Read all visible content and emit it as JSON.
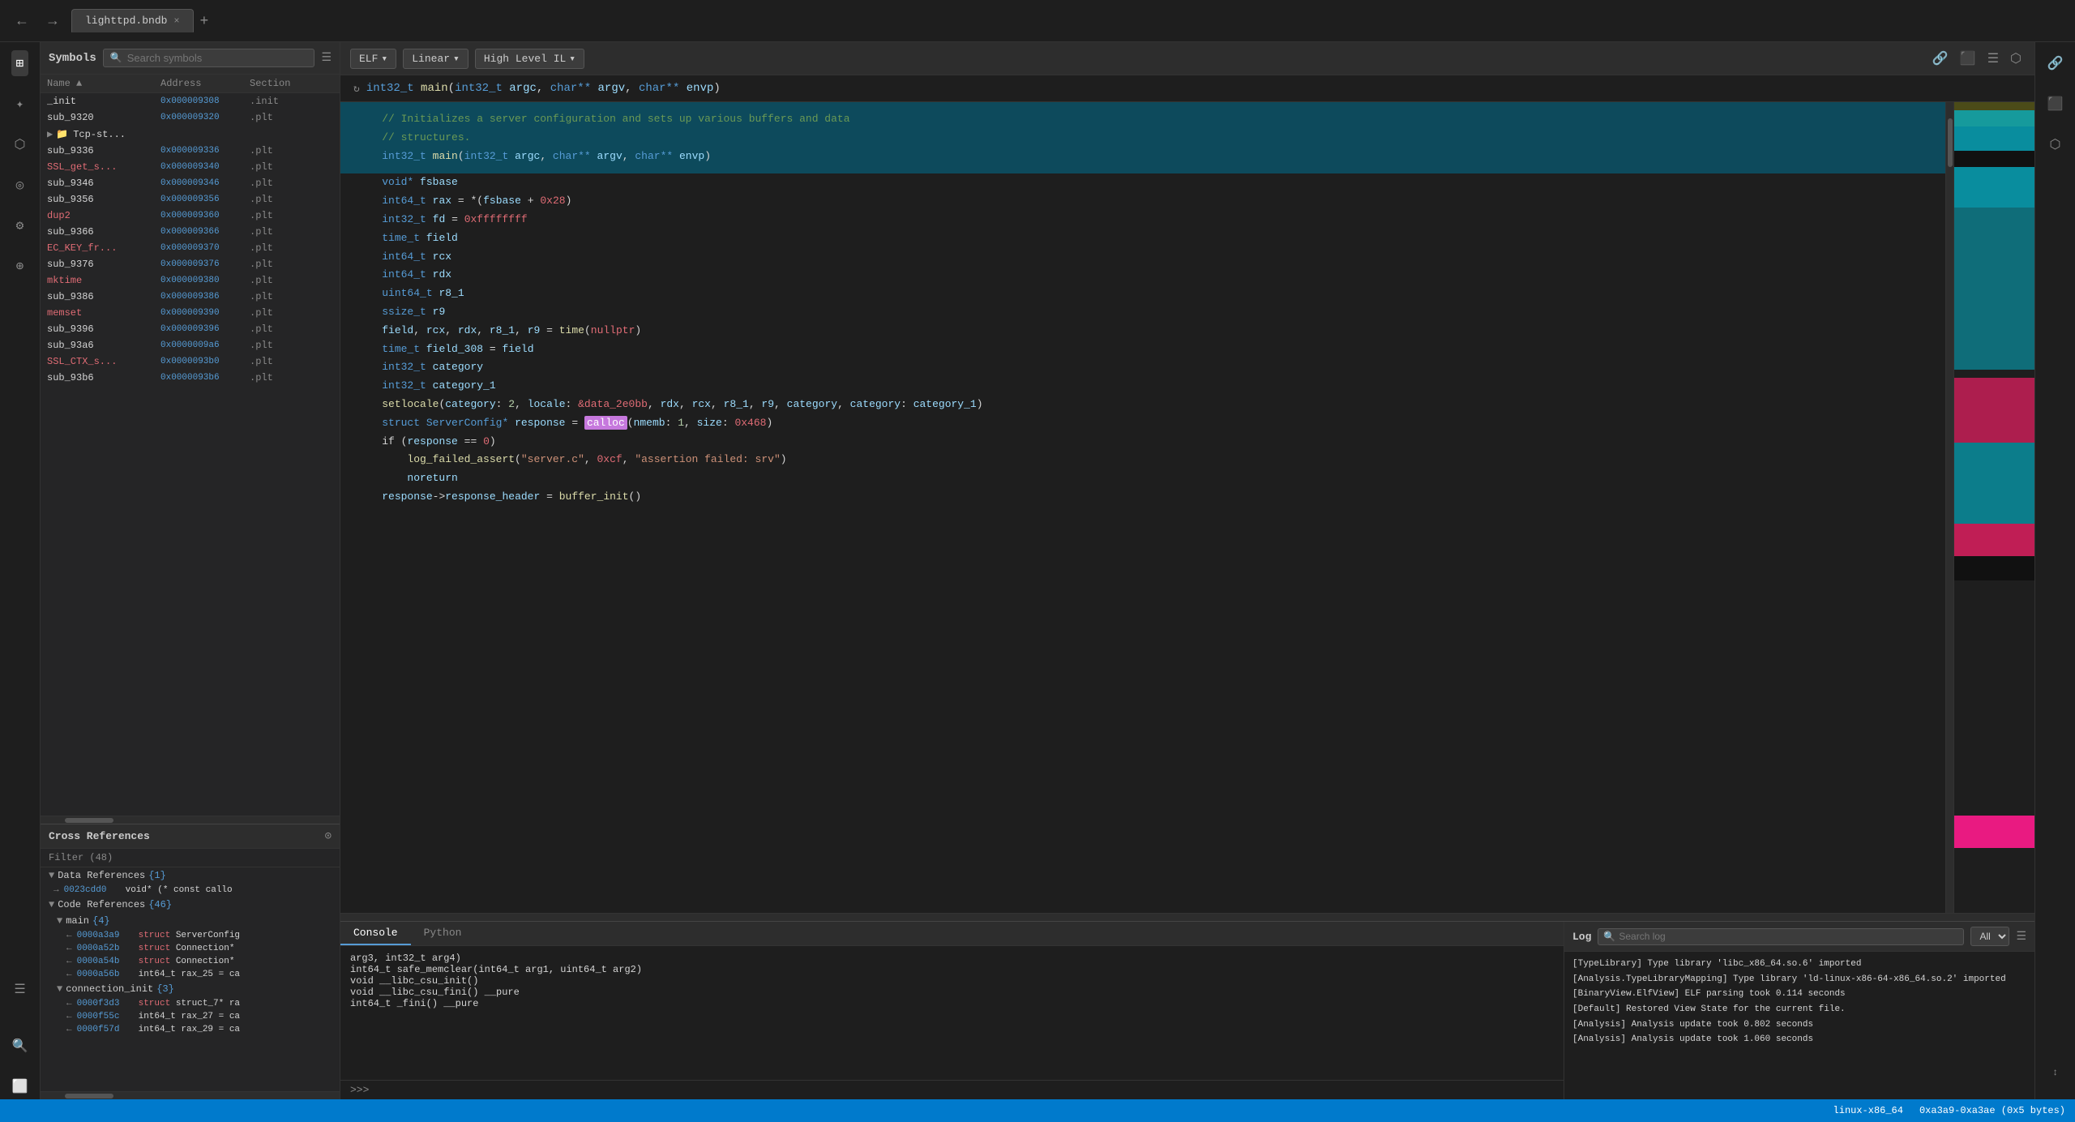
{
  "app": {
    "title": "lighttpd.bndb",
    "tab_close": "×",
    "new_tab": "+"
  },
  "nav": {
    "back": "←",
    "forward": "→"
  },
  "sidebar_icons": [
    "⊞",
    "✦",
    "⬡",
    "◉",
    "⚙",
    "⊕",
    "☰"
  ],
  "symbols_panel": {
    "title": "Symbols",
    "search_placeholder": "Search symbols",
    "menu_icon": "☰",
    "columns": [
      "Name",
      "Address",
      "Section"
    ],
    "rows": [
      {
        "name": "_init",
        "addr": "0x000009308",
        "section": ".init",
        "style": "default"
      },
      {
        "name": "sub_9320",
        "addr": "0x000009320",
        "section": ".plt",
        "style": "default"
      },
      {
        "name": "Tcp-st...",
        "addr": "",
        "section": "",
        "style": "folder"
      },
      {
        "name": "sub_9336",
        "addr": "0x000009336",
        "section": ".plt",
        "style": "default"
      },
      {
        "name": "SSL_get_s...",
        "addr": "0x000009340",
        "section": ".plt",
        "style": "pink"
      },
      {
        "name": "sub_9346",
        "addr": "0x000009346",
        "section": ".plt",
        "style": "default"
      },
      {
        "name": "sub_9356",
        "addr": "0x000009356",
        "section": ".plt",
        "style": "default"
      },
      {
        "name": "dup2",
        "addr": "0x000009360",
        "section": ".plt",
        "style": "pink"
      },
      {
        "name": "sub_9366",
        "addr": "0x000009366",
        "section": ".plt",
        "style": "default"
      },
      {
        "name": "EC_KEY_fr...",
        "addr": "0x000009370",
        "section": ".plt",
        "style": "pink"
      },
      {
        "name": "sub_9376",
        "addr": "0x000009376",
        "section": ".plt",
        "style": "default"
      },
      {
        "name": "mktime",
        "addr": "0x000009380",
        "section": ".plt",
        "style": "pink"
      },
      {
        "name": "sub_9386",
        "addr": "0x000009386",
        "section": ".plt",
        "style": "default"
      },
      {
        "name": "memset",
        "addr": "0x000009390",
        "section": ".plt",
        "style": "pink"
      },
      {
        "name": "sub_9396",
        "addr": "0x000009396",
        "section": ".plt",
        "style": "default"
      },
      {
        "name": "sub_93a6",
        "addr": "0x0000009a6",
        "section": ".plt",
        "style": "default"
      },
      {
        "name": "SSL_CTX_s...",
        "addr": "0x0000093b0",
        "section": ".plt",
        "style": "pink"
      },
      {
        "name": "sub_93b6",
        "addr": "0x0000093b6",
        "section": ".plt",
        "style": "default"
      }
    ]
  },
  "xrefs_panel": {
    "title": "Cross References",
    "pin_icon": "📌",
    "filter": "Filter (48)",
    "data_refs": {
      "label": "Data References",
      "badge": "{1}",
      "items": [
        {
          "arrow": "→",
          "addr": "0023cdd0",
          "content": "void* (* const callo"
        }
      ]
    },
    "code_refs": {
      "label": "Code References",
      "badge": "{46}",
      "sub_sections": [
        {
          "label": "main",
          "badge": "{4}",
          "items": [
            {
              "arrow": "←",
              "addr": "0000a3a9",
              "content": "struct ServerConfig"
            },
            {
              "arrow": "←",
              "addr": "0000a52b",
              "content": "struct Connection*"
            },
            {
              "arrow": "←",
              "addr": "0000a54b",
              "content": "struct Connection*"
            },
            {
              "arrow": "←",
              "addr": "0000a56b",
              "content": "int64_t rax_25 = ca"
            }
          ]
        },
        {
          "label": "connection_init",
          "badge": "{3}",
          "items": [
            {
              "arrow": "←",
              "addr": "0000f3d3",
              "content": "struct struct_7* ra"
            },
            {
              "arrow": "←",
              "addr": "0000f55c",
              "content": "int64_t rax_27 = ca"
            },
            {
              "arrow": "←",
              "addr": "0000f57d",
              "content": "int64_t rax_29 = ca"
            }
          ]
        }
      ]
    }
  },
  "toolbar": {
    "elf_label": "ELF",
    "linear_label": "Linear",
    "hlil_label": "High Level IL",
    "elf_arrow": "▾",
    "linear_arrow": "▾",
    "hlil_arrow": "▾",
    "link_icon": "🔗",
    "type_icon": "⬛",
    "menu_icon": "☰",
    "panel_icon": "⬡"
  },
  "code": {
    "function_sig": "int32_t main(int32_t argc, char** argv, char** envp)",
    "highlighted_comment1": "// Initializes a server configuration and sets up various buffers and data",
    "highlighted_comment2": "// structures.",
    "highlighted_sig": "int32_t main(int32_t argc, char** argv, char** envp)",
    "lines": [
      "    void* fsbase",
      "    int64_t rax = *(fsbase + 0x28)",
      "    int32_t fd = 0xffffffff",
      "    time_t field",
      "    int64_t rcx",
      "    int64_t rdx",
      "    uint64_t r8_1",
      "    ssize_t r9",
      "    field, rcx, rdx, r8_1, r9 = time(nullptr)",
      "    time_t field_308 = field",
      "    int32_t category",
      "    int32_t category_1",
      "    setlocale(category: 2, locale: &data_2e0bb, rdx, rcx, r8_1, r9, category, category: category_1)",
      "    struct ServerConfig* response = calloc(nmemb: 1, size: 0x468)",
      "    if (response == 0)",
      "        log_failed_assert(\"server.c\", 0xcf, \"assertion failed: srv\")",
      "        noreturn",
      "    response->response_header = buffer_init()"
    ]
  },
  "console": {
    "tabs": [
      "Console",
      "Python"
    ],
    "active_tab": "Console",
    "lines": [
      "arg3, int32_t arg4)",
      "int64_t safe_memclear(int64_t arg1, uint64_t arg2)",
      "void __libc_csu_init()",
      "void __libc_csu_fini() __pure",
      "int64_t _fini() __pure"
    ],
    "prompt": ">>>",
    "input_value": ""
  },
  "log": {
    "title": "Log",
    "search_placeholder": "Search log",
    "filter_options": [
      "All"
    ],
    "selected_filter": "All",
    "menu_icon": "☰",
    "entries": [
      "[TypeLibrary] Type library 'libc_x86_64.so.6' imported",
      "[Analysis.TypeLibraryMapping] Type library 'ld-linux-x86-64-x86_64.so.2' imported",
      "[BinaryView.ElfView] ELF parsing took 0.114 seconds",
      "[Default] Restored View State for the current file.",
      "[Analysis] Analysis update took 0.802 seconds",
      "[Analysis] Analysis update took 1.060 seconds"
    ]
  },
  "status_bar": {
    "arch": "linux-x86_64",
    "address_range": "0xa3a9-0xa3ae (0x5 bytes)"
  }
}
